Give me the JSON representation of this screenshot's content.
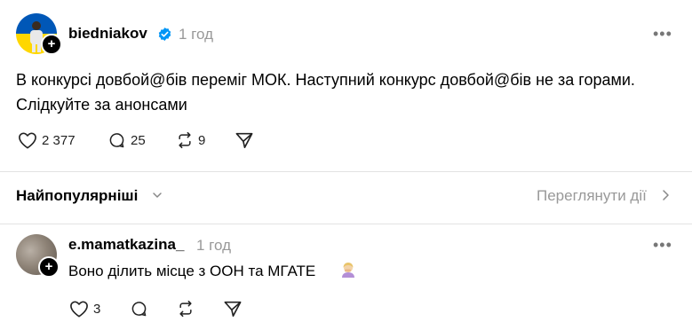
{
  "post": {
    "username": "biedniakov",
    "time": "1 год",
    "text": "В конкурсі довбой@бів переміг МОК. Наступний конкурс довбой@бів не за горами. Слідкуйте за анонсами",
    "likes": "2 377",
    "comments": "25",
    "reposts": "9",
    "avatar_colors": [
      "#0057b7",
      "#ffd700"
    ]
  },
  "sort": {
    "label": "Найпопулярніші",
    "view_activity": "Переглянути дії"
  },
  "comment": {
    "username": "e.mamatkazina_",
    "time": "1 год",
    "text": "Воно ділить місце з ООН та МГАТЕ",
    "emoji": "facepalm-woman",
    "likes": "3"
  },
  "icons": {
    "more": "more-icon",
    "like": "heart-icon",
    "comment": "comment-icon",
    "repost": "repost-icon",
    "share": "share-icon",
    "verified": "verified-badge-icon",
    "plus": "+"
  }
}
